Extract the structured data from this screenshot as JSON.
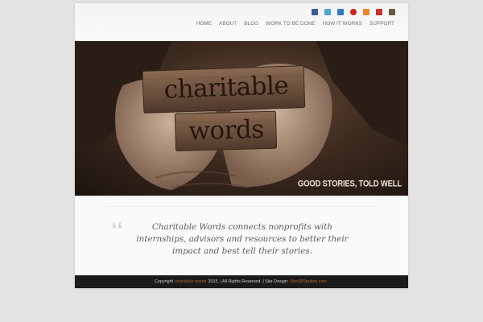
{
  "social": [
    {
      "icon": "facebook-icon",
      "color": "#3b5998"
    },
    {
      "icon": "twitter-icon",
      "color": "#4aa8d8"
    },
    {
      "icon": "blogger-icon",
      "color": "#2f79c4"
    },
    {
      "icon": "pinterest-icon",
      "color": "#cb2027"
    },
    {
      "icon": "rss-icon",
      "color": "#e8842a"
    },
    {
      "icon": "youtube-icon",
      "color": "#c4302b"
    },
    {
      "icon": "instagram-icon",
      "color": "#6b5a4a"
    }
  ],
  "nav": [
    {
      "label": "HOME"
    },
    {
      "label": "ABOUT"
    },
    {
      "label": "BLOG"
    },
    {
      "label": "WORK TO BE DONE"
    },
    {
      "label": "HOW IT WORKS"
    },
    {
      "label": "SUPPORT"
    }
  ],
  "hero": {
    "block1": "charitable",
    "block2": "words",
    "caption": "GOOD STORIES, TOLD WELL"
  },
  "quote": {
    "mark": "❛❛",
    "text": "Charitable Words connects nonprofits with internships, advisors and resources to better their impact and best tell their stories."
  },
  "footer": {
    "prefix": "Copyright",
    "brand": "charitable words",
    "middle": "2015. | All Rights Reserved. | Site Design:",
    "designer": "Don38Studios.com"
  },
  "colors": {
    "accent": "#b06a2a",
    "footer_bg": "#1b1b1b"
  }
}
